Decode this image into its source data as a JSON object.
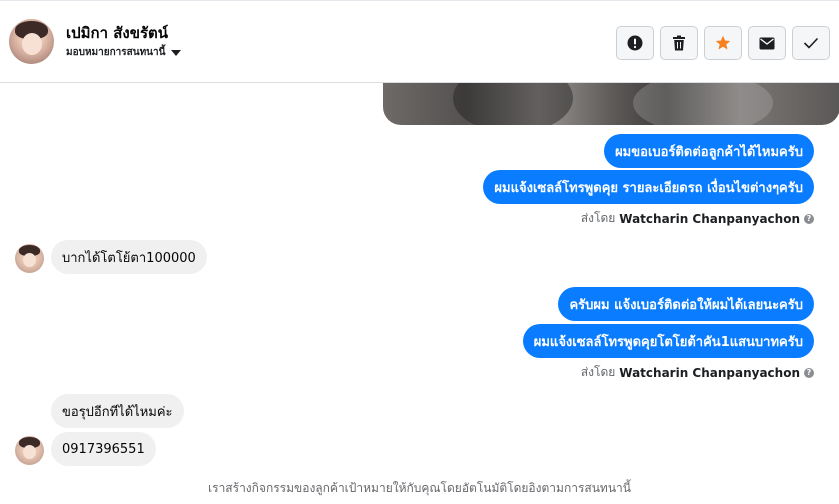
{
  "header": {
    "contact_name": "เปมิกา สังขรัตน์",
    "assign_label": "มอบหมายการสนทนานี้",
    "actions": [
      {
        "icon": "alert-icon",
        "label": "Mark as spam"
      },
      {
        "icon": "trash-icon",
        "label": "Delete"
      },
      {
        "icon": "star-icon",
        "label": "Star"
      },
      {
        "icon": "envelope-icon",
        "label": "Mark as unread"
      },
      {
        "icon": "check-icon",
        "label": "Mark as done"
      }
    ]
  },
  "messages": [
    {
      "direction": "out",
      "text": "ผมขอเบอร์ติดต่อลูกค้าได้ไหมครับ"
    },
    {
      "direction": "out",
      "text": "ผมแจ้งเซลล์โทรพูดคุย รายละเอียดรถ เงื่อนไขต่างๆครับ"
    },
    {
      "direction": "meta",
      "prefix": "ส่งโดย",
      "sender": "Watcharin Chanpanyachon"
    },
    {
      "direction": "in",
      "text": "บากได้โตโย้ตา100000"
    },
    {
      "direction": "out",
      "text": "ครับผม แจ้งเบอร์ติดต่อให้ผมได้เลยนะครับ"
    },
    {
      "direction": "out",
      "text": "ผมแจ้งเซลล์โทรพูดคุยโตโยต้าคัน1แสนบาทครับ"
    },
    {
      "direction": "meta",
      "prefix": "ส่งโดย",
      "sender": "Watcharin Chanpanyachon"
    },
    {
      "direction": "in",
      "text": "ขอรุปอีกทีได้ไหมค่ะ"
    },
    {
      "direction": "in",
      "text": "0917396551"
    }
  ],
  "footer_note": "เราสร้างกิจกรรมของลูกค้าเป้าหมายให้กับคุณโดยอัตโนมัติโดยอิงตามการสนทนานี้",
  "colors": {
    "outgoing_bubble": "#0a7cff",
    "incoming_bubble": "#f0f0f0",
    "star_accent": "#f5821f"
  }
}
